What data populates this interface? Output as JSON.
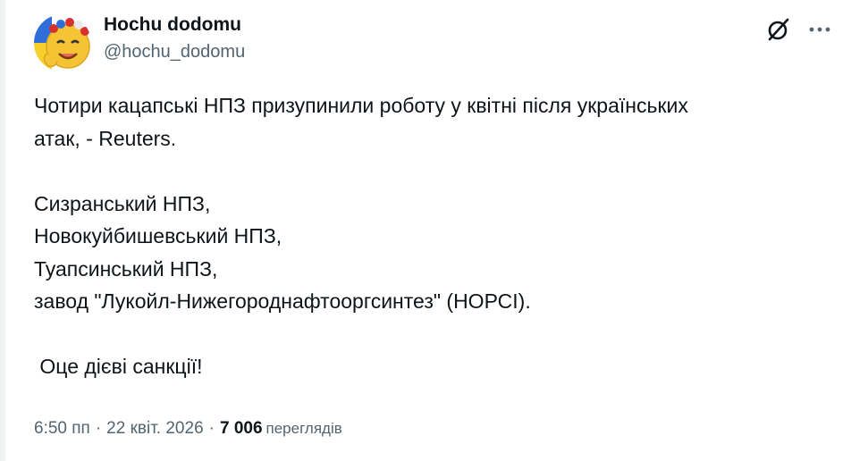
{
  "author": {
    "display_name": "Hochu dodomu",
    "handle": "@hochu_dodomu",
    "avatar_icon": "smiling-sun-avatar-icon"
  },
  "actions": {
    "grok_icon": "grok-slash-circle-icon",
    "more_icon": "more-dots-icon"
  },
  "tweet": {
    "line1": "Чотири кацапські НПЗ призупинили роботу у квітні після українських",
    "line2": "атак, - Reuters.",
    "line3": "Сизранський НПЗ,",
    "line4": "Новокуйбишевський НПЗ,",
    "line5": "Туапсинський НПЗ,",
    "line6": "завод \"Лукойл-Нижегороднафтооргсинтез\" (НОРСІ).",
    "line7": " Оце дієві санкції!"
  },
  "meta": {
    "time": "6:50 пп",
    "date": "22 квіт. 2026",
    "views_count": "7 006",
    "views_label": "переглядів"
  },
  "colors": {
    "text": "#0f1419",
    "secondary": "#536471",
    "divider": "#eff3f4"
  }
}
